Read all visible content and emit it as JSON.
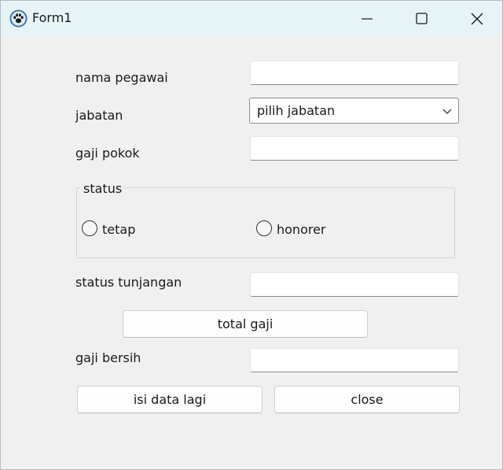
{
  "window": {
    "title": "Form1",
    "app_icon": "paw-icon",
    "controls": [
      "minimize-icon",
      "maximize-icon",
      "close-icon"
    ]
  },
  "form": {
    "nama_pegawai": {
      "label": "nama pegawai",
      "value": ""
    },
    "jabatan": {
      "label": "jabatan",
      "selected": "pilih jabatan"
    },
    "gaji_pokok": {
      "label": "gaji pokok",
      "value": ""
    },
    "status_group": {
      "title": "status",
      "options": [
        "tetap",
        "honorer"
      ]
    },
    "status_tunjangan": {
      "label": "status tunjangan",
      "value": ""
    },
    "total_gaji_button": "total gaji",
    "gaji_bersih": {
      "label": "gaji bersih",
      "value": ""
    },
    "isi_data_lagi_button": "isi data lagi",
    "close_button": "close"
  }
}
